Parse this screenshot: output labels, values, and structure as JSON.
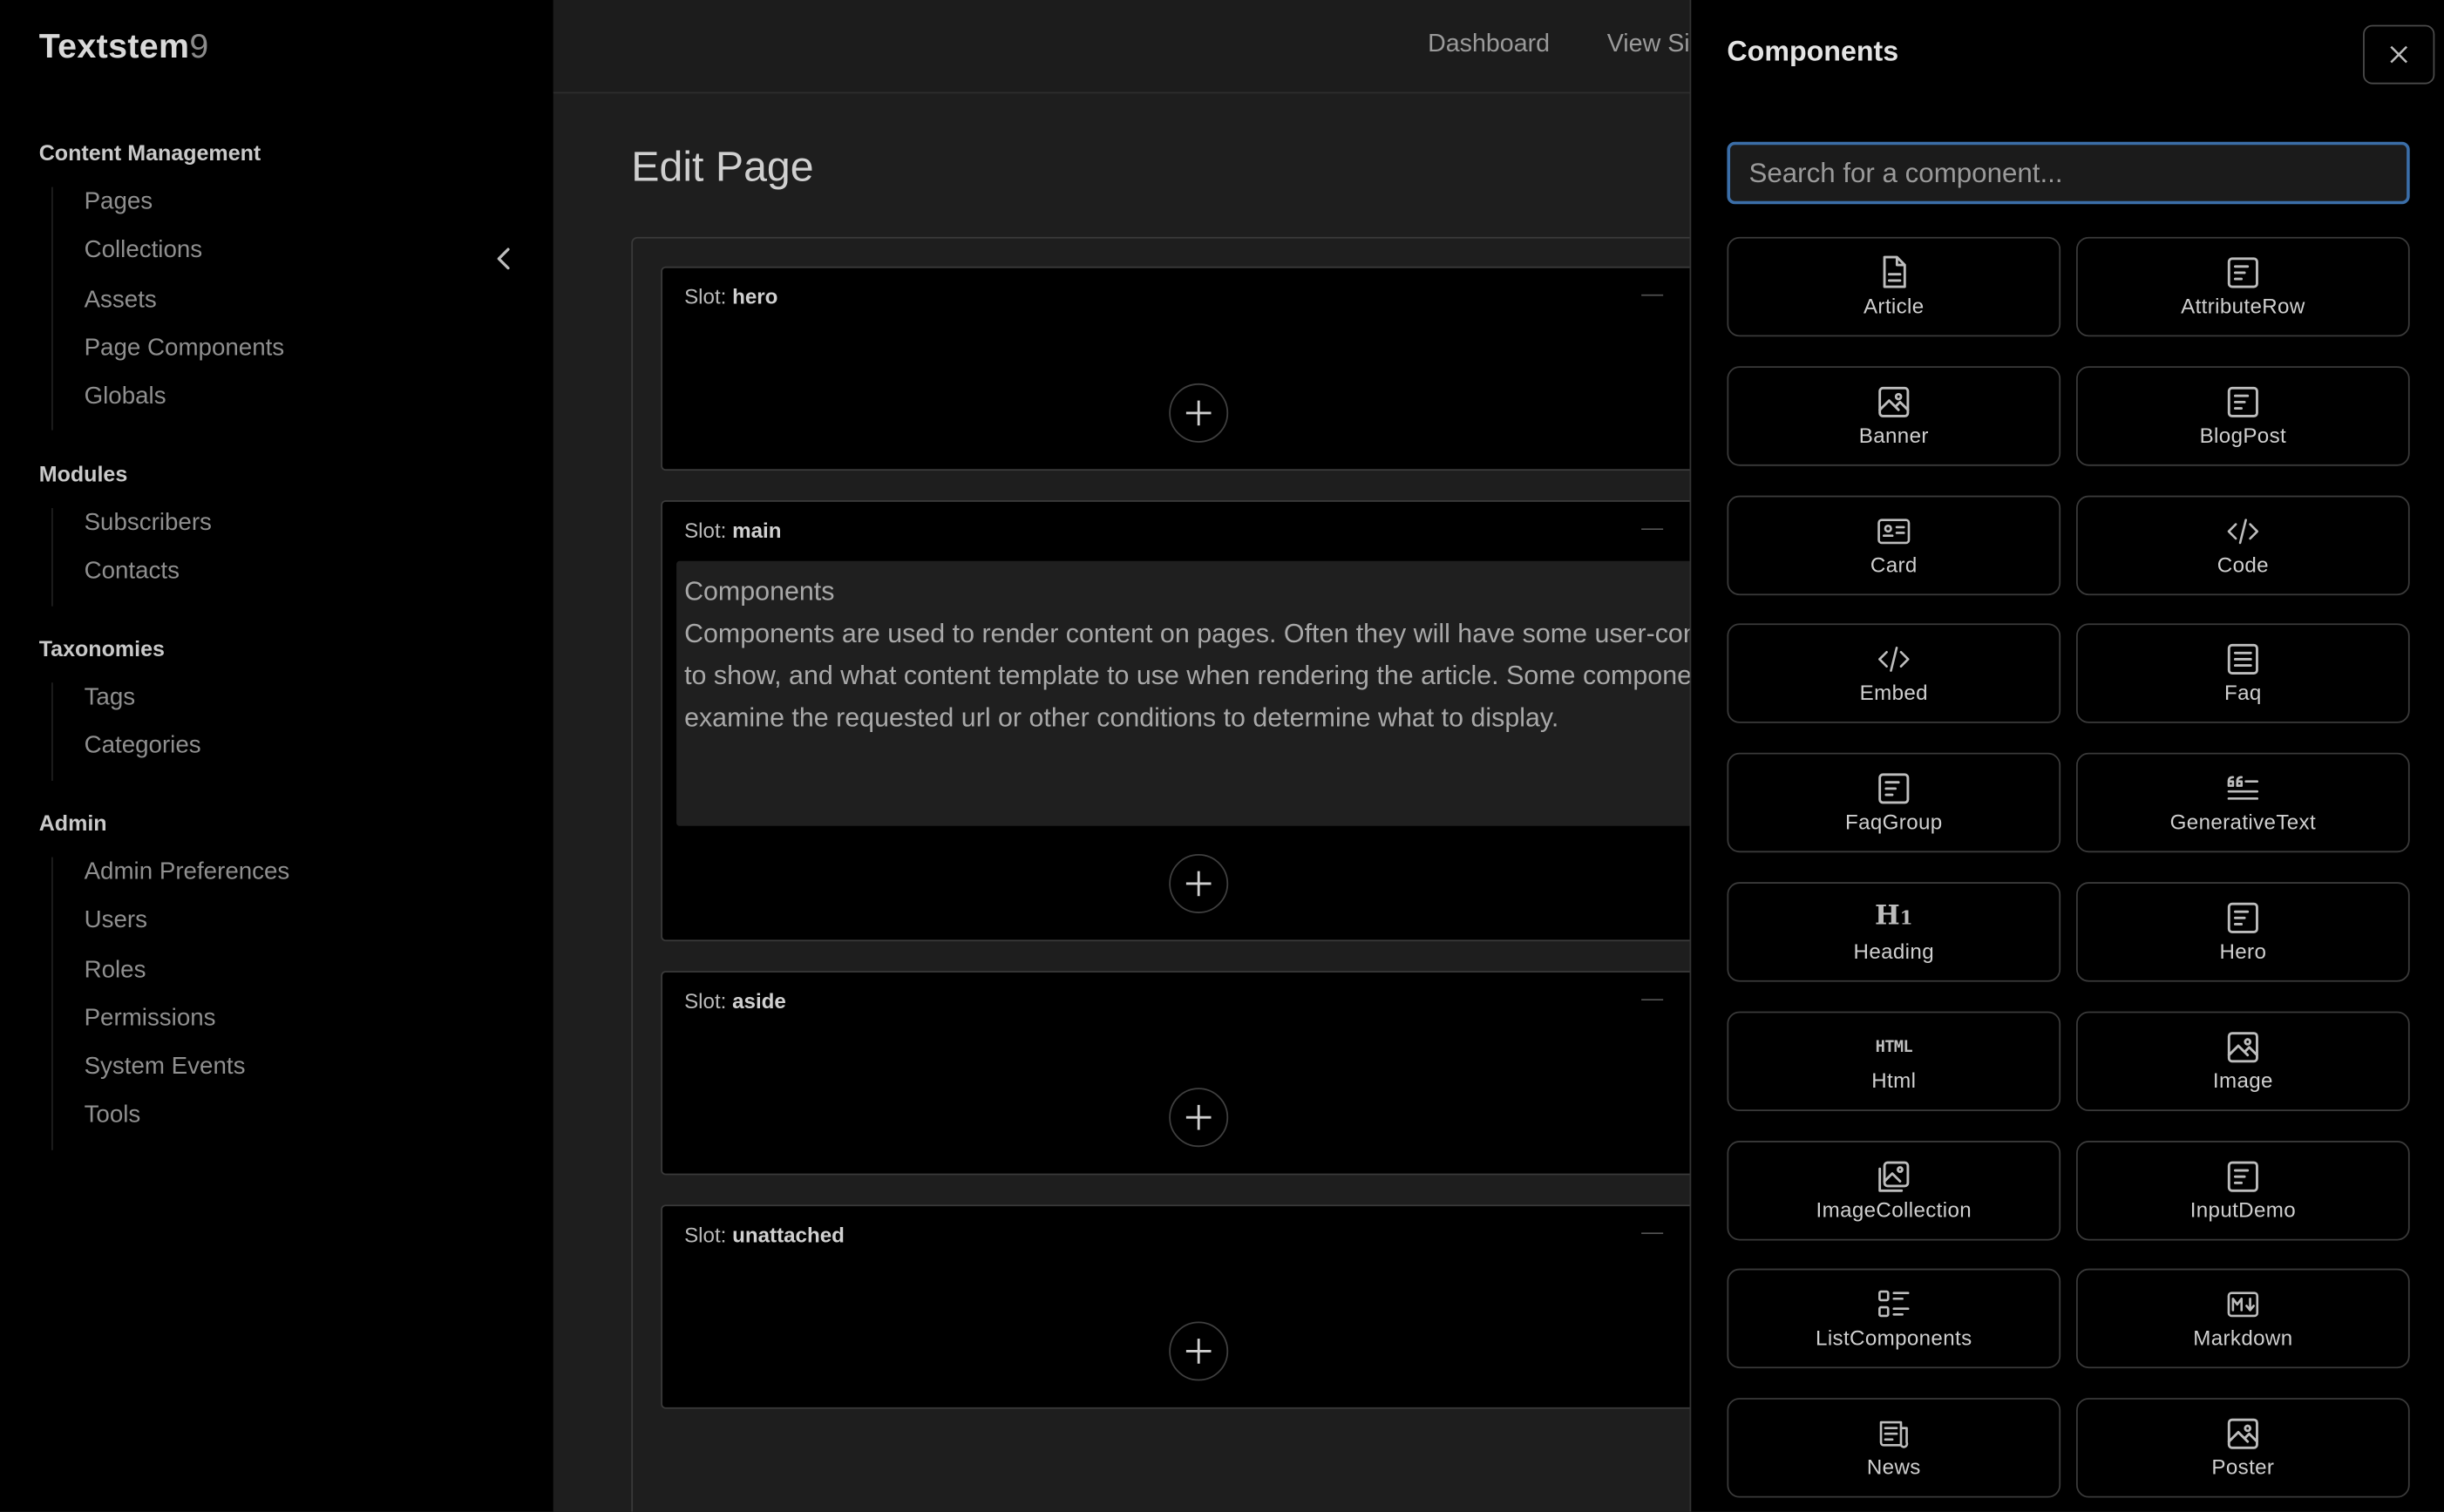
{
  "brand": {
    "name": "Textstem",
    "suffix": "9"
  },
  "sidebar": {
    "groups": [
      {
        "title": "Content Management",
        "items": [
          "Pages",
          "Collections",
          "Assets",
          "Page Components",
          "Globals"
        ]
      },
      {
        "title": "Modules",
        "items": [
          "Subscribers",
          "Contacts"
        ]
      },
      {
        "title": "Taxonomies",
        "items": [
          "Tags",
          "Categories"
        ]
      },
      {
        "title": "Admin",
        "items": [
          "Admin Preferences",
          "Users",
          "Roles",
          "Permissions",
          "System Events",
          "Tools"
        ]
      }
    ]
  },
  "topnav": {
    "dashboard": "Dashboard",
    "view_site": "View Si"
  },
  "main": {
    "title": "Edit Page",
    "slot_prefix": "Slot:",
    "slots": [
      {
        "name": "hero"
      },
      {
        "name": "main"
      },
      {
        "name": "aside"
      },
      {
        "name": "unattached"
      }
    ],
    "component_block": {
      "title": "Components",
      "body": "Components are used to render content on pages. Often they will have some user-configurable settings such as what article to show, and what content template to use when rendering the article. Some components are 'smart components' and will examine the requested url or other conditions to determine what to display."
    }
  },
  "drawer": {
    "title": "Components",
    "search_placeholder": "Search for a component...",
    "components": [
      {
        "label": "Article",
        "icon": "document-icon"
      },
      {
        "label": "AttributeRow",
        "icon": "text-block-icon"
      },
      {
        "label": "Banner",
        "icon": "image-icon"
      },
      {
        "label": "BlogPost",
        "icon": "text-block-icon"
      },
      {
        "label": "Card",
        "icon": "id-card-icon"
      },
      {
        "label": "Code",
        "icon": "code-icon"
      },
      {
        "label": "Embed",
        "icon": "code-icon"
      },
      {
        "label": "Faq",
        "icon": "list-icon"
      },
      {
        "label": "FaqGroup",
        "icon": "text-block-icon"
      },
      {
        "label": "GenerativeText",
        "icon": "quote-icon"
      },
      {
        "label": "Heading",
        "icon": "heading-icon"
      },
      {
        "label": "Hero",
        "icon": "text-block-icon"
      },
      {
        "label": "Html",
        "icon": "html-icon"
      },
      {
        "label": "Image",
        "icon": "image-icon"
      },
      {
        "label": "ImageCollection",
        "icon": "images-icon"
      },
      {
        "label": "InputDemo",
        "icon": "text-block-icon"
      },
      {
        "label": "ListComponents",
        "icon": "list-details-icon"
      },
      {
        "label": "Markdown",
        "icon": "markdown-icon"
      },
      {
        "label": "News",
        "icon": "news-icon"
      },
      {
        "label": "Poster",
        "icon": "image-icon"
      }
    ]
  }
}
